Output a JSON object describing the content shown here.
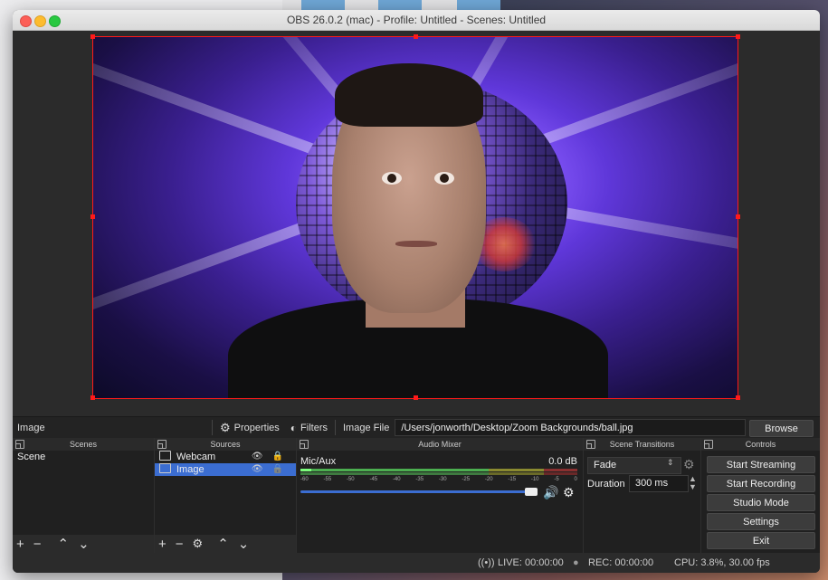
{
  "window": {
    "title": "OBS 26.0.2 (mac) - Profile: Untitled - Scenes: Untitled"
  },
  "colors": {
    "accent": "#3b6dd1",
    "selection": "#ff1a1a",
    "panel": "#202020",
    "toolbar": "#232323"
  },
  "properties_bar": {
    "selected_source": "Image",
    "properties_label": "Properties",
    "filters_label": "Filters",
    "field_label": "Image File",
    "file_path": "/Users/jonworth/Desktop/Zoom Backgrounds/ball.jpg",
    "browse_label": "Browse",
    "properties_icon": "gear-icon",
    "filters_icon": "filter-icon"
  },
  "docks": {
    "scenes": {
      "title": "Scenes",
      "items": [
        "Scene"
      ]
    },
    "sources": {
      "title": "Sources",
      "items": [
        {
          "name": "Webcam",
          "icon": "camera-icon",
          "visible": true,
          "locked": true
        },
        {
          "name": "Image",
          "icon": "image-icon",
          "visible": true,
          "locked": false
        }
      ]
    },
    "audio_mixer": {
      "title": "Audio Mixer",
      "channel": "Mic/Aux",
      "level": "0.0 dB",
      "scale": [
        "-60",
        "-55",
        "-50",
        "-45",
        "-40",
        "-35",
        "-30",
        "-25",
        "-20",
        "-15",
        "-10",
        "-5",
        "0"
      ],
      "volume": 1.0
    },
    "scene_transitions": {
      "title": "Scene Transitions",
      "transition": "Fade",
      "duration_label": "Duration",
      "duration": "300 ms"
    },
    "controls": {
      "title": "Controls",
      "buttons": [
        "Start Streaming",
        "Start Recording",
        "Studio Mode",
        "Settings",
        "Exit"
      ]
    }
  },
  "status": {
    "live": "LIVE: 00:00:00",
    "rec": "REC: 00:00:00",
    "cpu": "CPU: 3.8%, 30.00 fps"
  }
}
